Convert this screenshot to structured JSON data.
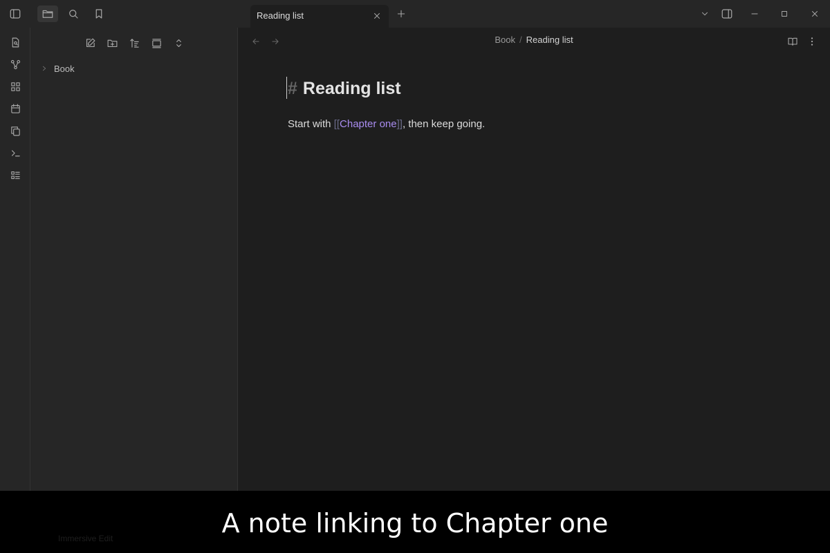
{
  "tab": {
    "title": "Reading list"
  },
  "sidebar": {
    "folder_label": "Book"
  },
  "editor": {
    "breadcrumb_parent": "Book",
    "breadcrumb_separator": "/",
    "breadcrumb_current": "Reading list",
    "heading_hash": "#",
    "heading_text": "Reading list",
    "para_before": "Start with ",
    "link_open": "[[",
    "link_text": "Chapter one",
    "link_close": "]]",
    "para_after": ", then keep going."
  },
  "status": {
    "left_text": "Immersive Edit"
  },
  "caption": "A note linking to Chapter one",
  "colors": {
    "accent_link": "#a98cf0",
    "background": "#1e1e1e",
    "sidebar": "#262626"
  }
}
